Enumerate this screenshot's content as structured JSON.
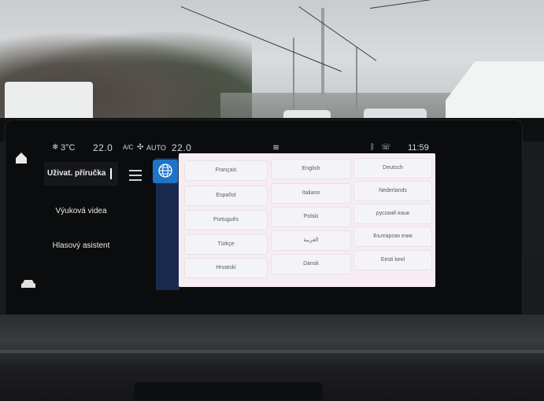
{
  "status_bar": {
    "temperature_outside": "3°C",
    "temp_left": "22.0",
    "ac_label": "A/C",
    "auto_label": "AUTO",
    "temp_right": "22.0",
    "time": "11:59"
  },
  "menu": {
    "items": [
      {
        "label": "Uživat. příručka",
        "active": true
      },
      {
        "label": "Výuková videa",
        "active": false
      },
      {
        "label": "Hlasový asistent",
        "active": false
      }
    ]
  },
  "languages": [
    [
      "Français",
      "English",
      "Deutsch"
    ],
    [
      "Español",
      "Italiano",
      "Nederlands"
    ],
    [
      "Português",
      "Polski",
      "русский язык"
    ],
    [
      "Türkçe",
      "العربية",
      "Български език"
    ],
    [
      "Hrvatski",
      "Dansk",
      "Eesti keel"
    ]
  ],
  "colors": {
    "accent": "#1f74c8",
    "panel_bg": "#f7ecf2",
    "screen_bg": "#0b0c0d"
  },
  "icons": [
    "home-icon",
    "snowflake-icon",
    "fan-icon",
    "seat-heat-icon",
    "bluetooth-icon",
    "phone-icon",
    "menu-icon",
    "globe-icon",
    "car-icon"
  ]
}
